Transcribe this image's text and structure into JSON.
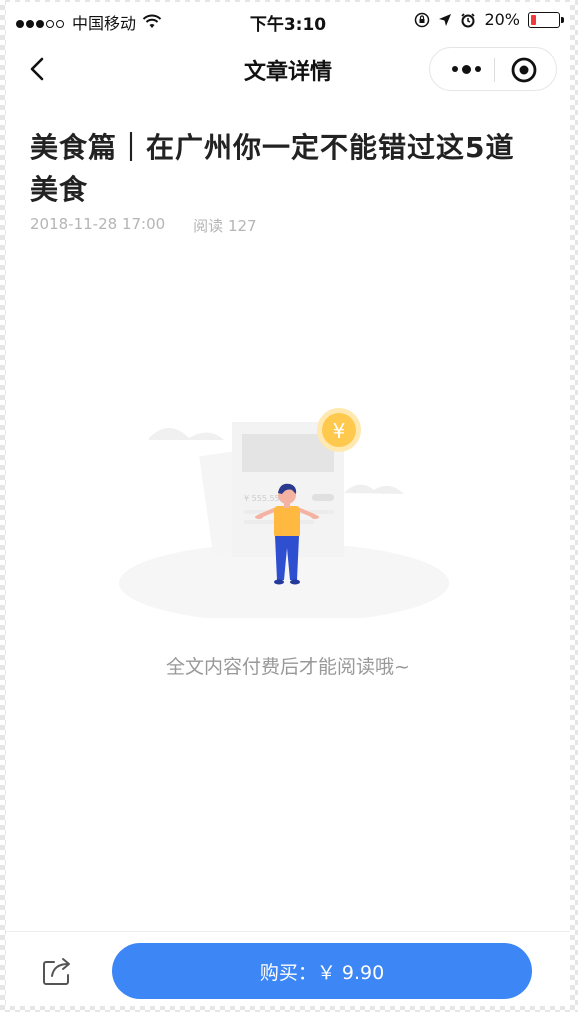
{
  "status_bar": {
    "carrier": "中国移动",
    "time": "下午3:10",
    "battery_percent_text": "20%",
    "battery_level": 0.2
  },
  "nav": {
    "title": "文章详情"
  },
  "article": {
    "title": "美食篇｜在广州你一定不能错过这5道美食",
    "date": "2018-11-28 17:00",
    "read_label": "阅读 127"
  },
  "illustration": {
    "price_on_card": "¥ 555.55",
    "coin_symbol": "¥"
  },
  "paywall": {
    "message": "全文内容付费后才能阅读哦~"
  },
  "bottom_bar": {
    "buy_label": "购买：￥ 9.90"
  },
  "colors": {
    "accent": "#3d86f5",
    "battery_low": "#f23b3b",
    "coin": "#ffc94d"
  }
}
